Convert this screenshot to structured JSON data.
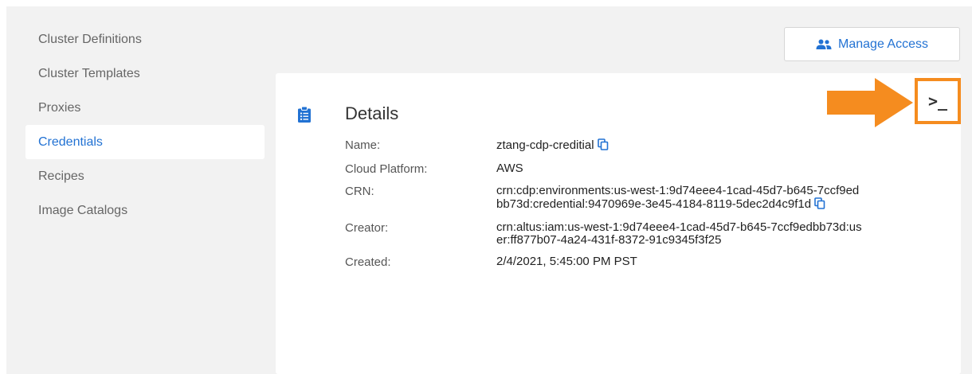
{
  "sidebar": {
    "items": [
      {
        "label": "Cluster Definitions",
        "active": false
      },
      {
        "label": "Cluster Templates",
        "active": false
      },
      {
        "label": "Proxies",
        "active": false
      },
      {
        "label": "Credentials",
        "active": true
      },
      {
        "label": "Recipes",
        "active": false
      },
      {
        "label": "Image Catalogs",
        "active": false
      }
    ]
  },
  "header": {
    "manage_access_label": "Manage Access",
    "manage_access_icon": "users-icon"
  },
  "card": {
    "title": "Details",
    "title_icon": "clipboard-list-icon",
    "terminal_label": ">_",
    "rows": {
      "name": {
        "label": "Name:",
        "value": "ztang-cdp-creditial"
      },
      "cloud_platform": {
        "label": "Cloud Platform:",
        "value": "AWS"
      },
      "crn": {
        "label": "CRN:",
        "value": "crn:cdp:environments:us-west-1:9d74eee4-1cad-45d7-b645-7ccf9edbb73d:credential:9470969e-3e45-4184-8119-5dec2d4c9f1d"
      },
      "creator": {
        "label": "Creator:",
        "value": "crn:altus:iam:us-west-1:9d74eee4-1cad-45d7-b645-7ccf9edbb73d:user:ff877b07-4a24-431f-8372-91c9345f3f25"
      },
      "created": {
        "label": "Created:",
        "value": "2/4/2021, 5:45:00 PM PST"
      }
    }
  },
  "colors": {
    "accent": "#2272d3",
    "highlight": "#f58c1f",
    "panel_bg": "#f2f2f2"
  }
}
